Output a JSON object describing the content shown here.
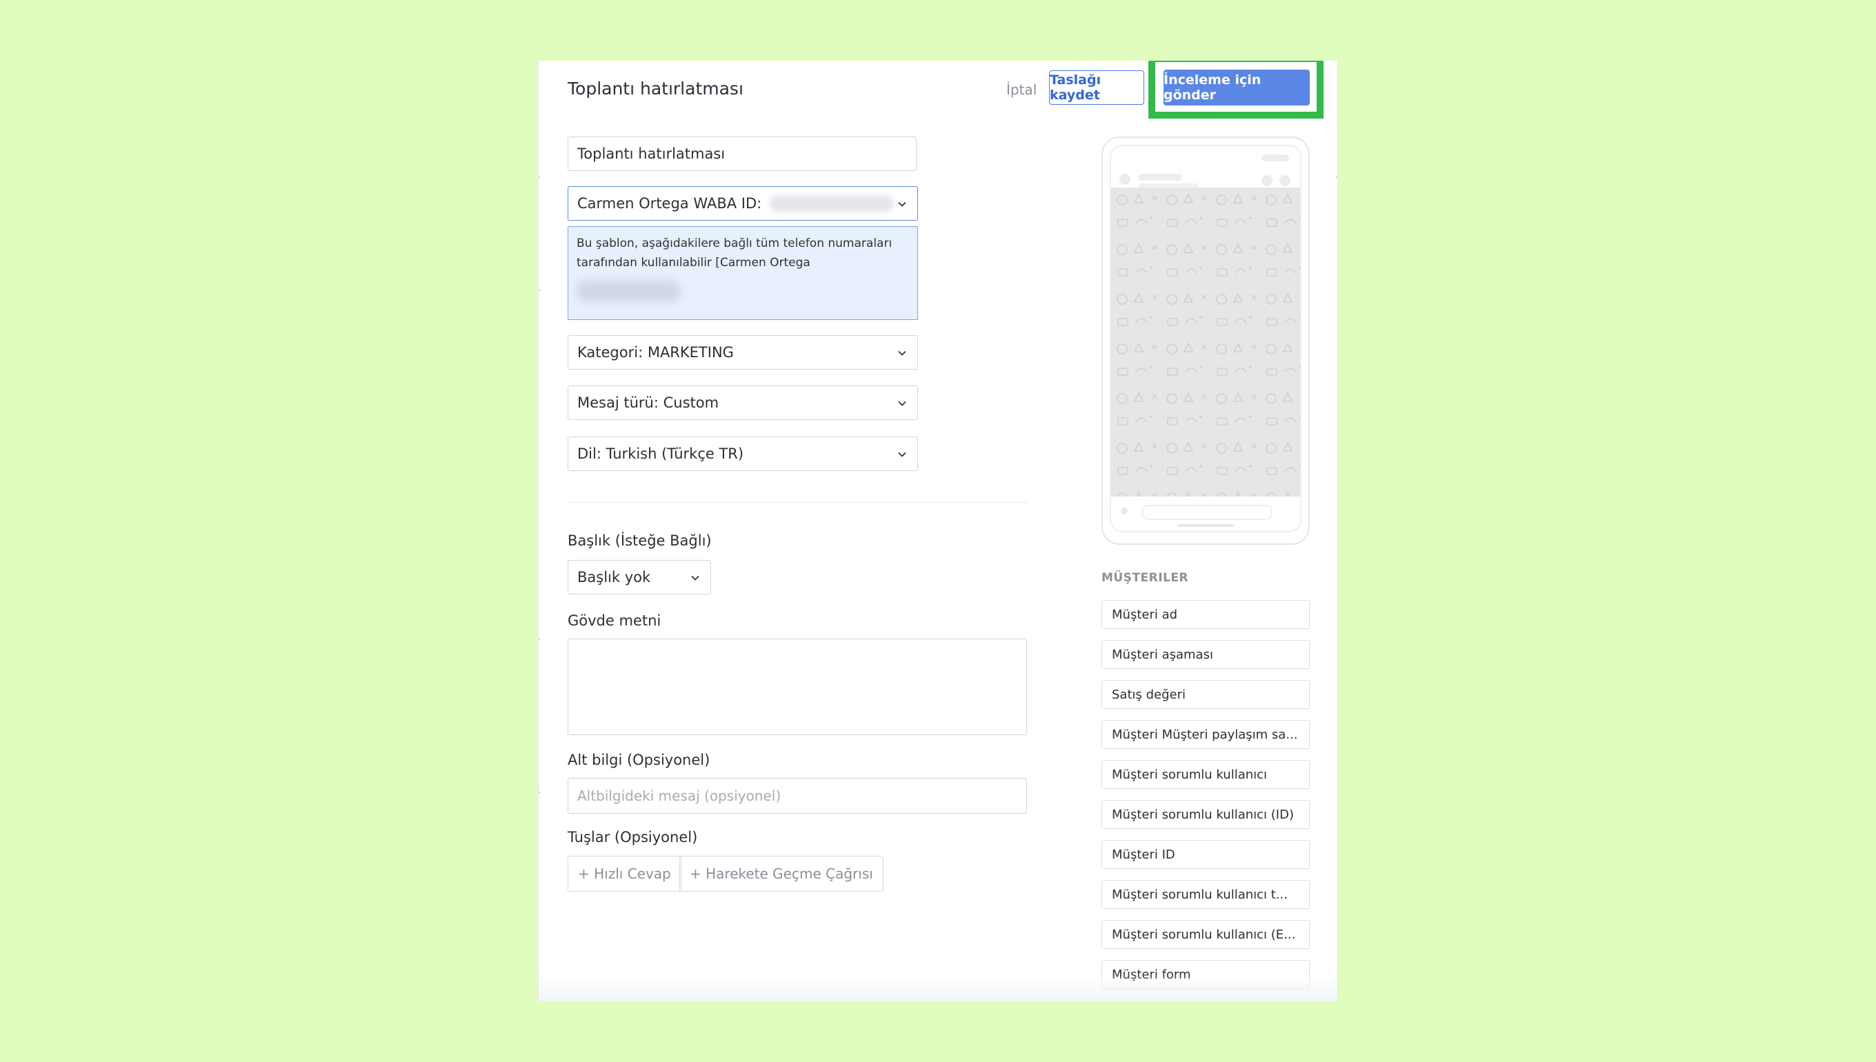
{
  "header": {
    "title": "Toplantı hatırlatması",
    "cancel_label": "İptal",
    "save_draft_label": "Taslağı kaydet",
    "submit_label": "İnceleme için gönder"
  },
  "form": {
    "name_value": "Toplantı hatırlatması",
    "waba_label": "Carmen Ortega WABA ID:",
    "info_line1": "Bu şablon, aşağıdakilere bağlı tüm telefon numaraları",
    "info_line2": "tarafından kullanılabilir [Carmen Ortega",
    "category_label": "Kategori: MARKETING",
    "message_type_label": "Mesaj türü: Custom",
    "language_label": "Dil: Turkish (Türkçe TR)",
    "header_section_label": "Başlık (İsteğe Bağlı)",
    "header_select_value": "Başlık yok",
    "body_label": "Gövde metni",
    "footer_label": "Alt bilgi (Opsiyonel)",
    "footer_placeholder": "Altbilgideki mesaj (opsiyonel)",
    "buttons_label": "Tuşlar (Opsiyonel)",
    "quick_reply_label": "+ Hızlı Cevap",
    "cta_label": "+ Harekete Geçme Çağrısı"
  },
  "sidebar": {
    "section_title": "MÜŞTERILER",
    "items": [
      "Müşteri ad",
      "Müşteri aşaması",
      "Satış değeri",
      "Müşteri Müşteri paylaşım sa...",
      "Müşteri sorumlu kullanıcı",
      "Müşteri sorumlu kullanıcı (ID)",
      "Müşteri ID",
      "Müşteri sorumlu kullanıcı t...",
      "Müşteri sorumlu kullanıcı (E...",
      "Müşteri form"
    ]
  },
  "colors": {
    "background": "#e1fcbf",
    "primary": "#5a87e6",
    "highlight": "#34b94b"
  }
}
